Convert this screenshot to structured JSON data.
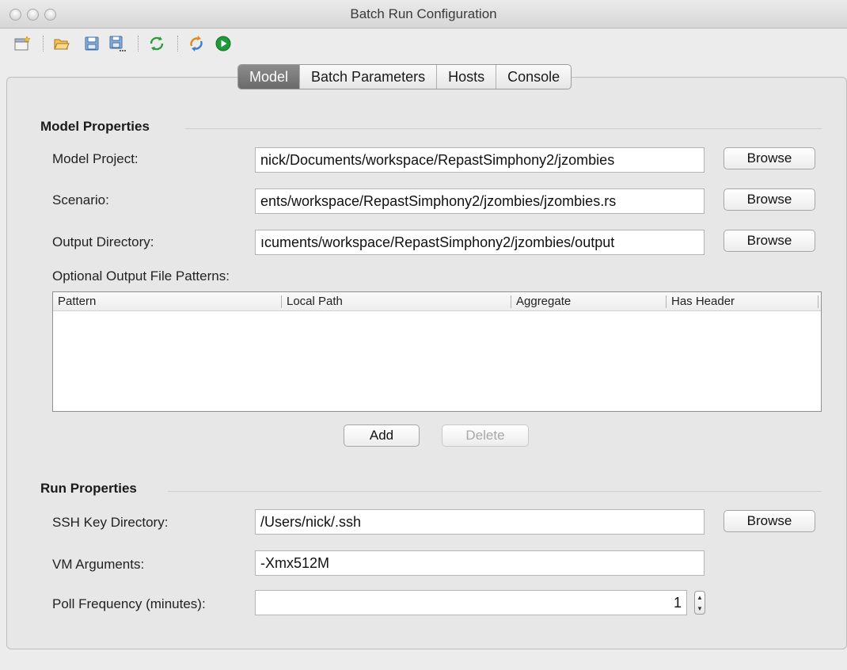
{
  "window": {
    "title": "Batch Run Configuration"
  },
  "toolbar": {
    "icons": [
      "new-config-icon",
      "open-folder-icon",
      "save-icon",
      "save-as-icon",
      "refresh-icon",
      "reload-icon",
      "run-icon"
    ]
  },
  "tabs": [
    "Model",
    "Batch Parameters",
    "Hosts",
    "Console"
  ],
  "active_tab": "Model",
  "model_properties": {
    "title": "Model Properties",
    "model_project": {
      "label": "Model Project:",
      "value": "nick/Documents/workspace/RepastSimphony2/jzombies"
    },
    "scenario": {
      "label": "Scenario:",
      "value": "ents/workspace/RepastSimphony2/jzombies/jzombies.rs"
    },
    "output_directory": {
      "label": "Output Directory:",
      "value": "ıcuments/workspace/RepastSimphony2/jzombies/output"
    },
    "browse_label": "Browse",
    "patterns_label": "Optional Output File Patterns:",
    "columns": [
      "Pattern",
      "Local Path",
      "Aggregate",
      "Has Header"
    ],
    "add_label": "Add",
    "delete_label": "Delete"
  },
  "run_properties": {
    "title": "Run Properties",
    "ssh_key": {
      "label": "SSH Key Directory:",
      "value": "/Users/nick/.ssh"
    },
    "vm_args": {
      "label": "VM Arguments:",
      "value": "-Xmx512M"
    },
    "poll": {
      "label": "Poll Frequency (minutes):",
      "value": "1"
    },
    "browse_label": "Browse"
  },
  "colors": {
    "run_green": "#2a9d2a",
    "folder_orange": "#e8a23a",
    "save_blue": "#3b6ea8",
    "active_tab": "#7a7a7a"
  }
}
